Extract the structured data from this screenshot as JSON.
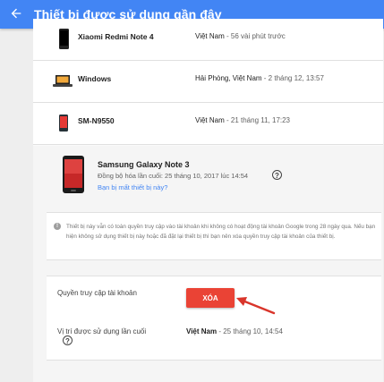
{
  "appbar": {
    "title": "Thiết bị được sử dụng gần đây",
    "back_icon": "arrow-back-icon",
    "color": "#4285f4"
  },
  "devices": [
    {
      "name": "Xiaomi Redmi Note 4",
      "location": "Việt Nam",
      "time": " - 56 vài phút trước",
      "icon": "smartphone-icon"
    },
    {
      "name": "Windows",
      "location": "Hải Phòng, Việt Nam",
      "time": " - 2 tháng 12, 13:57",
      "icon": "laptop-icon"
    },
    {
      "name": "SM-N9550",
      "location": "Việt Nam",
      "time": " - 21 tháng 11, 17:23",
      "icon": "smartphone-red-icon"
    }
  ],
  "selected": {
    "name": "Samsung Galaxy Note 3",
    "sync": "Đồng bộ hóa lần cuối: 25 tháng 10, 2017 lúc 14:54",
    "lost_link": "Bạn bị mất thiết bị này?",
    "warning": "Thiết bị này vẫn có toàn quyền truy cập vào tài khoản khi không có hoạt động tài khoản Google trong 28 ngày qua. Nếu bạn hiện không sử dụng thiết bị này hoặc đã đặt lại thiết bị thì bạn nên xóa quyền truy cập tài khoản của thiết bị.",
    "access_label": "Quyền truy cập tài khoản",
    "delete_label": "XÓA",
    "delete_color": "#ea4335",
    "location_label": "Vị trí được sử dụng lần cuối",
    "location_value": "Việt Nam",
    "location_time": " - 25 tháng 10, 14:54"
  }
}
